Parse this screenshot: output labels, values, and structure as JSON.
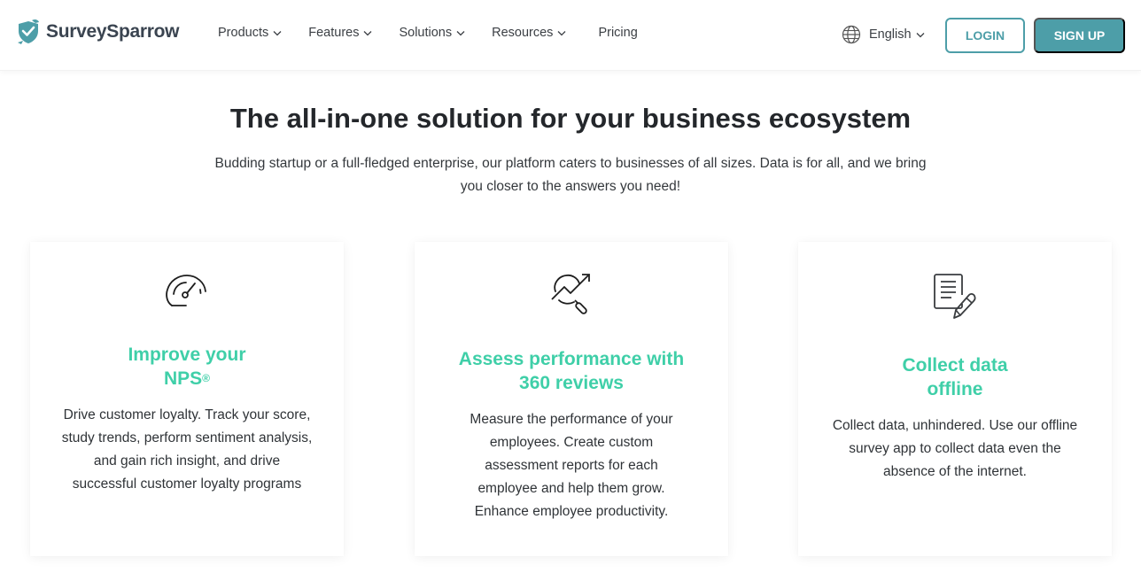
{
  "header": {
    "brand": "SurveySparrow",
    "logo_icon": "sparrow-check-logo",
    "nav": [
      {
        "label": "Products",
        "has_dropdown": true
      },
      {
        "label": "Features",
        "has_dropdown": true
      },
      {
        "label": "Solutions",
        "has_dropdown": true
      },
      {
        "label": "Resources",
        "has_dropdown": true
      },
      {
        "label": "Pricing",
        "has_dropdown": false
      }
    ],
    "language": {
      "icon": "globe-icon",
      "label": "English"
    },
    "login_label": "LOGIN",
    "signup_label": "SIGN UP"
  },
  "hero": {
    "title": "The all-in-one solution for your business ecosystem",
    "subtitle": "Budding startup or a full-fledged enterprise, our platform caters to businesses of all sizes. Data is for all, and we bring you closer to the answers you need!"
  },
  "cards": [
    {
      "icon": "speedometer-icon",
      "title_line1": "Improve your",
      "title_line2": "NPS",
      "title_mark": "®",
      "description": "Drive customer loyalty. Track your score, study trends, perform sentiment analysis, and gain rich insight, and drive successful customer loyalty programs"
    },
    {
      "icon": "growth-magnifier-icon",
      "title_line1": "Assess performance with",
      "title_line2": "360 reviews",
      "description": "Measure the performance of your employees. Create custom assessment reports for each employee and help them grow. Enhance employee productivity."
    },
    {
      "icon": "document-pencil-icon",
      "title_line1": "Collect data",
      "title_line2": "offline",
      "description": "Collect data, unhindered. Use our offline survey app to collect data even the absence of the internet."
    }
  ],
  "colors": {
    "brand_teal": "#4d9ea8",
    "accent_green": "#3fcfa8",
    "text_dark": "#24272b"
  }
}
